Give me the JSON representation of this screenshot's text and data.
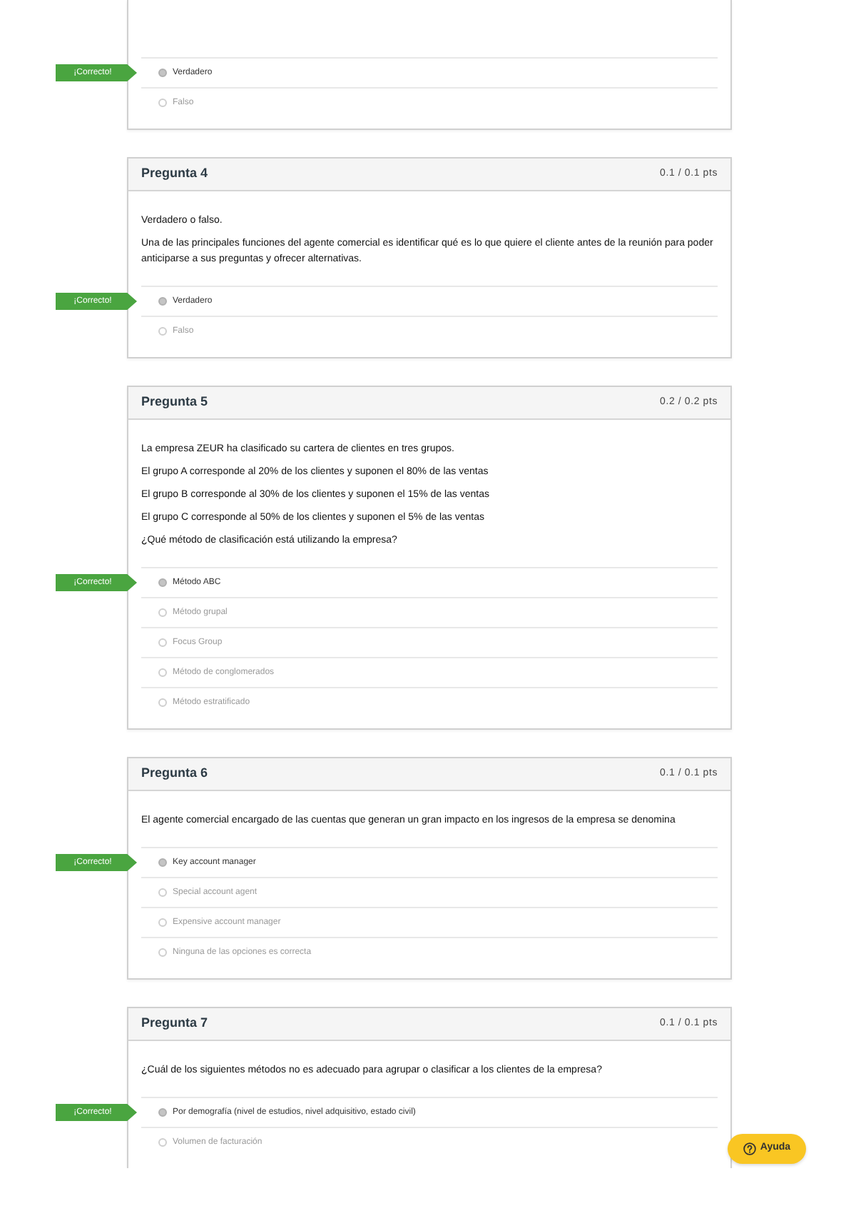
{
  "questions": [
    {
      "feedback": "¡Correcto!",
      "options": [
        {
          "label": "Verdadero",
          "selected": true
        },
        {
          "label": "Falso",
          "selected": false
        }
      ]
    },
    {
      "title": "Pregunta 4",
      "score": "0.1 / 0.1 pts",
      "prompt": [
        "Verdadero o falso.",
        "Una de las principales funciones del agente comercial es identificar qué es lo que quiere el cliente antes de la reunión para poder anticiparse a sus preguntas y ofrecer alternativas."
      ],
      "feedback": "¡Correcto!",
      "options": [
        {
          "label": "Verdadero",
          "selected": true
        },
        {
          "label": "Falso",
          "selected": false
        }
      ]
    },
    {
      "title": "Pregunta 5",
      "score": "0.2 / 0.2 pts",
      "prompt": [
        "La empresa ZEUR ha clasificado su cartera de clientes en tres grupos.",
        "El grupo A corresponde al 20% de los clientes y suponen el 80% de las ventas",
        "El grupo B corresponde al 30% de los clientes y suponen el 15% de las ventas",
        "El grupo C corresponde al 50% de los clientes y suponen el 5% de las ventas",
        "¿Qué método de clasificación está utilizando la empresa?"
      ],
      "feedback": "¡Correcto!",
      "options": [
        {
          "label": "Método ABC",
          "selected": true
        },
        {
          "label": "Método grupal",
          "selected": false
        },
        {
          "label": "Focus Group",
          "selected": false
        },
        {
          "label": "Método de conglomerados",
          "selected": false
        },
        {
          "label": "Método estratificado",
          "selected": false
        }
      ]
    },
    {
      "title": "Pregunta 6",
      "score": "0.1 / 0.1 pts",
      "prompt": [
        "El agente comercial encargado de las cuentas que generan un gran impacto en los ingresos de la empresa se denomina"
      ],
      "feedback": "¡Correcto!",
      "options": [
        {
          "label": "Key account manager",
          "selected": true
        },
        {
          "label": "Special account agent",
          "selected": false
        },
        {
          "label": "Expensive account manager",
          "selected": false
        },
        {
          "label": "Ninguna de las opciones es correcta",
          "selected": false
        }
      ]
    },
    {
      "title": "Pregunta 7",
      "score": "0.1 / 0.1 pts",
      "prompt": [
        "¿Cuál de los siguientes métodos no es adecuado para agrupar o clasificar a los clientes de la empresa?"
      ],
      "feedback": "¡Correcto!",
      "options": [
        {
          "label": "Por demografía (nivel de estudios, nivel adquisitivo, estado civil)",
          "selected": true
        },
        {
          "label": "Volumen de facturación",
          "selected": false
        }
      ]
    }
  ],
  "help_button": {
    "label": "Ayuda"
  }
}
